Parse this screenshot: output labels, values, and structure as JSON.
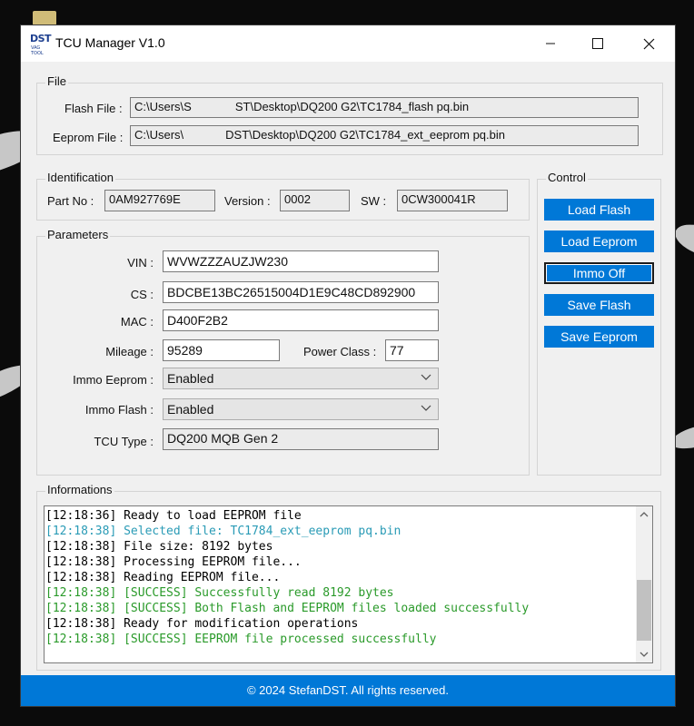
{
  "window": {
    "title": "TCU Manager V1.0",
    "logo_text": "DST",
    "logo_subtext": "VAG TOOL"
  },
  "file_group": {
    "label": "File",
    "flash_label": "Flash File :",
    "flash_path_1": "C:\\Users\\S",
    "flash_path_2": "ST\\Desktop\\DQ200 G2\\TC1784_flash pq.bin",
    "eeprom_label": "Eeprom File :",
    "eeprom_path_1": "C:\\Users\\",
    "eeprom_path_2": "DST\\Desktop\\DQ200 G2\\TC1784_ext_eeprom pq.bin"
  },
  "identification": {
    "label": "Identification",
    "part_no_label": "Part No :",
    "part_no": "0AM927769E",
    "version_label": "Version :",
    "version": "0002",
    "sw_label": "SW :",
    "sw": "0CW300041R"
  },
  "parameters": {
    "label": "Parameters",
    "vin_label": "VIN :",
    "vin": "WVWZZZAUZJW230",
    "cs_label": "CS :",
    "cs": "BDCBE13BC26515004D1E9C48CD892900",
    "mac_label": "MAC :",
    "mac": "D400F2B2",
    "mileage_label": "Mileage :",
    "mileage": "95289",
    "power_class_label": "Power Class :",
    "power_class": "77",
    "immo_eeprom_label": "Immo Eeprom :",
    "immo_eeprom": "Enabled",
    "immo_flash_label": "Immo Flash :",
    "immo_flash": "Enabled",
    "tcu_type_label": "TCU Type :",
    "tcu_type": "DQ200 MQB Gen 2"
  },
  "control": {
    "label": "Control",
    "buttons": [
      "Load Flash",
      "Load Eeprom",
      "Immo Off",
      "Save Flash",
      "Save Eeprom"
    ]
  },
  "informations": {
    "label": "Informations",
    "log": [
      {
        "text": "[12:18:36] Ready to load EEPROM file",
        "color": "#000000"
      },
      {
        "text": "[12:18:38] Selected file: TC1784_ext_eeprom pq.bin",
        "color": "#2a9bb6"
      },
      {
        "text": "[12:18:38] File size: 8192 bytes",
        "color": "#000000"
      },
      {
        "text": "[12:18:38] Processing EEPROM file...",
        "color": "#000000"
      },
      {
        "text": "[12:18:38] Reading EEPROM file...",
        "color": "#000000"
      },
      {
        "text": "[12:18:38] [SUCCESS] Successfully read 8192 bytes",
        "color": "#2a9a2a"
      },
      {
        "text": "[12:18:38] [SUCCESS] Both Flash and EEPROM files loaded successfully",
        "color": "#2a9a2a"
      },
      {
        "text": "[12:18:38] Ready for modification operations",
        "color": "#000000"
      },
      {
        "text": "[12:18:38] [SUCCESS] EEPROM file processed successfully",
        "color": "#2a9a2a"
      }
    ]
  },
  "footer": {
    "text": "© 2024 StefanDST. All rights reserved."
  },
  "colors": {
    "accent": "#0078d7",
    "success": "#2a9a2a",
    "info": "#2a9bb6"
  }
}
